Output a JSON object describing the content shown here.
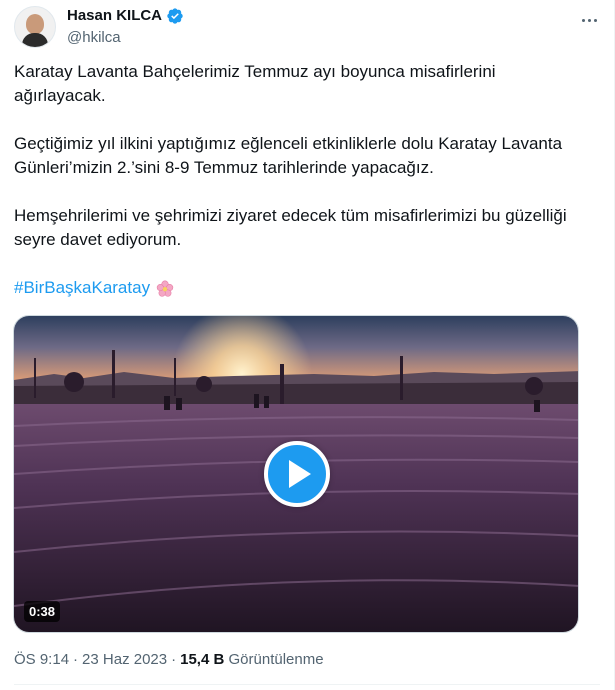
{
  "author": {
    "name": "Hasan KILCA",
    "handle": "@hkilca",
    "verified": true
  },
  "tweet": {
    "paragraphs": [
      "Karatay Lavanta Bahçelerimiz Temmuz ayı boyunca misafirlerini ağırlayacak.",
      "Geçtiğimiz yıl ilkini yaptığımız eğlenceli etkinliklerle dolu Karatay Lavanta Günleri’mizin 2.’sini 8-9 Temmuz tarihlerinde yapacağız.",
      "Hemşehrilerimi ve şehrimizi ziyaret edecek tüm misafirlerimizi bu güzelliği seyre davet ediyorum."
    ],
    "hashtag": "#BirBaşkaKaratay",
    "emoji_icon": "cherry-blossom-icon"
  },
  "media": {
    "type": "video",
    "duration": "0:38",
    "play_icon": "play-icon"
  },
  "meta": {
    "time": "ÖS 9:14",
    "separator": "·",
    "date": "23 Haz 2023",
    "views_count": "15,4 B",
    "views_label": "Görüntülenme"
  },
  "colors": {
    "accent": "#1d9bf0",
    "text": "#0f1419",
    "muted": "#536471"
  }
}
